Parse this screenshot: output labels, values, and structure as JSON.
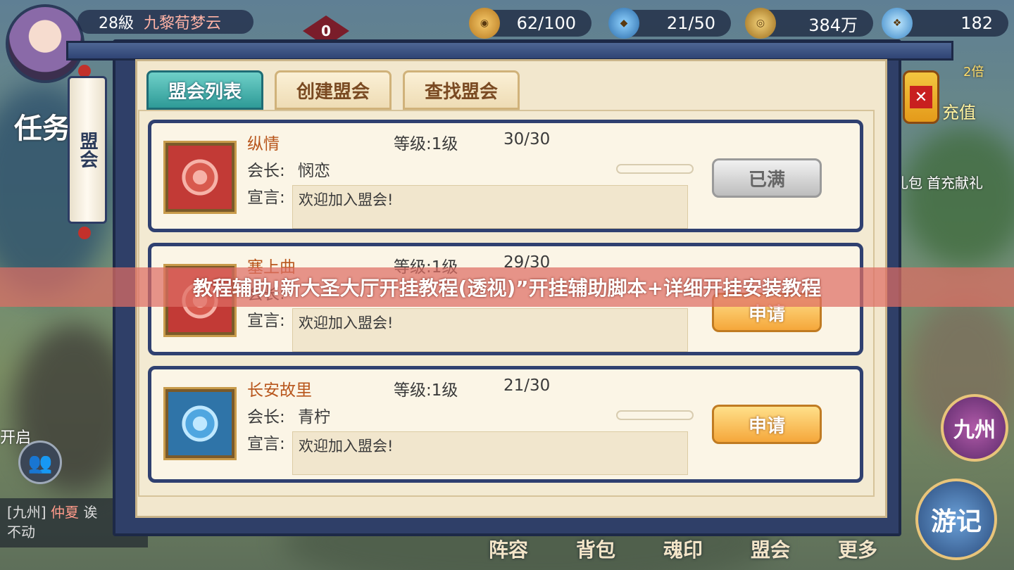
{
  "hud": {
    "level": "28級",
    "player_name": "九黎荀梦云",
    "red_badge": "0",
    "stamina": "62/100",
    "crystal": "21/50",
    "coins": "384万",
    "gems": "182"
  },
  "left": {
    "quest_label": "任务",
    "unlock_label": "开启",
    "chat_channel": "[九州]",
    "chat_name": "仲夏",
    "chat_text_tail": "诶",
    "chat_line2": "不动"
  },
  "right": {
    "recharge_label": "充值",
    "recharge_badge": "2倍",
    "gift_label": "首充献礼",
    "gift_short": "礼包",
    "region_btn": "九州",
    "travel_btn": "游记"
  },
  "bottom_nav": [
    "阵容",
    "背包",
    "魂印",
    "盟会",
    "更多"
  ],
  "panel": {
    "side_title": "盟会",
    "tabs": [
      "盟会列表",
      "创建盟会",
      "查找盟会"
    ],
    "level_prefix": "等级:",
    "leader_label": "会长:",
    "declaration_label": "宣言:",
    "guilds": [
      {
        "name": "纵情",
        "level": "1级",
        "members": "30/30",
        "leader": "悯恋",
        "declaration": "欢迎加入盟会!",
        "action": "已满",
        "emblem": "red"
      },
      {
        "name": "塞上曲",
        "level": "1级",
        "members": "29/30",
        "leader": "",
        "declaration": "欢迎加入盟会!",
        "action": "申请",
        "emblem": "red"
      },
      {
        "name": "长安故里",
        "level": "1级",
        "members": "21/30",
        "leader": "青柠",
        "declaration": "欢迎加入盟会!",
        "action": "申请",
        "emblem": "blue"
      }
    ]
  },
  "overlay_banner": "教程辅助!新大圣大厅开挂教程(透视)”开挂辅助脚本+详细开挂安装教程",
  "colors": {
    "accent_teal": "#2e9a97",
    "apply_orange": "#f5a73b",
    "frame_navy": "#2f3f68",
    "banner": "#de6e64"
  }
}
